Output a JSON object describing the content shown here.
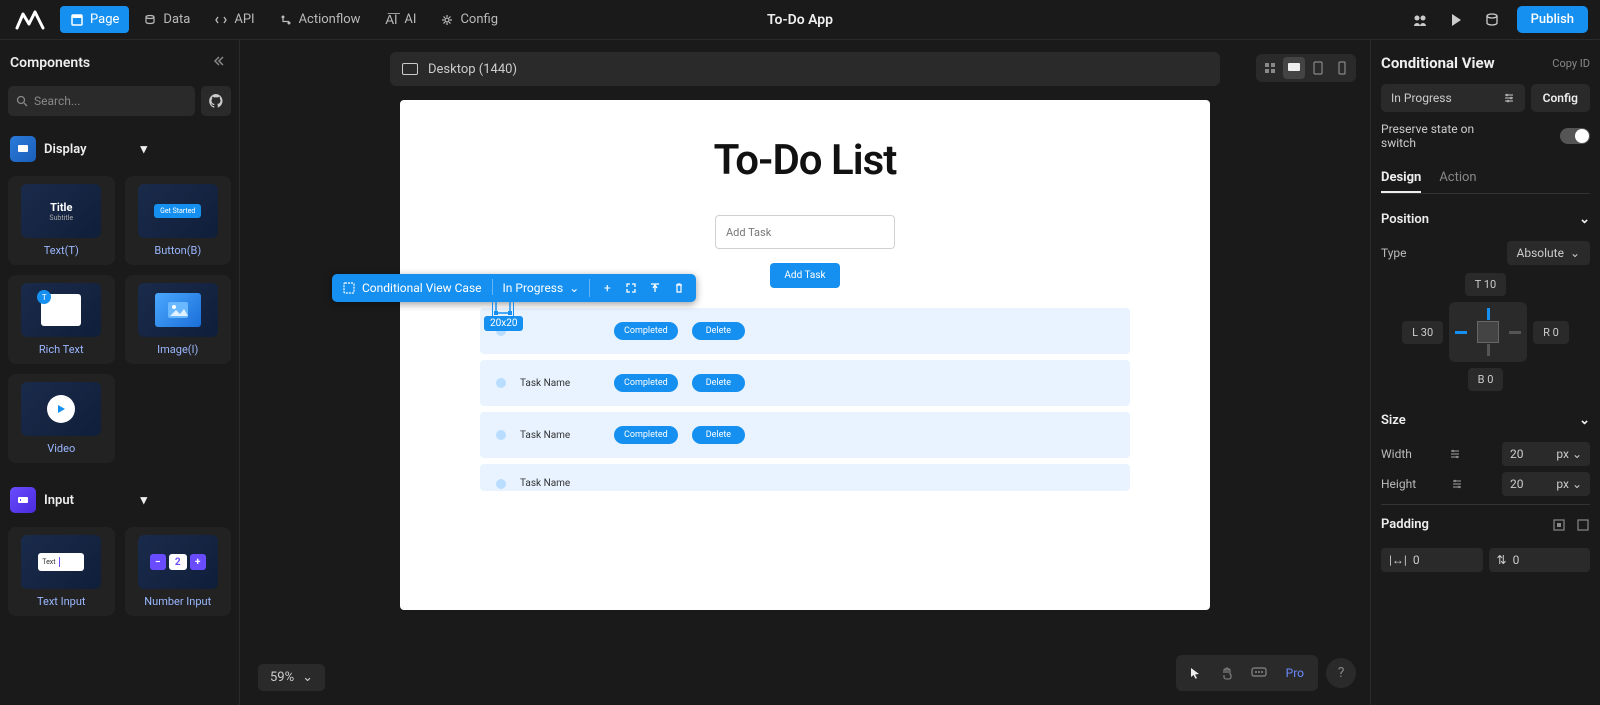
{
  "app_title": "To-Do App",
  "topnav": {
    "page": "Page",
    "data": "Data",
    "api": "API",
    "actionflow": "Actionflow",
    "ai": "AI",
    "config": "Config"
  },
  "publish": "Publish",
  "left": {
    "title": "Components",
    "search_placeholder": "Search...",
    "display_section": "Display",
    "input_section": "Input",
    "components": {
      "text": "Text(T)",
      "button": "Button(B)",
      "richtext": "Rich Text",
      "image": "Image(I)",
      "video": "Video",
      "textinput": "Text Input",
      "numberinput": "Number Input"
    },
    "previews": {
      "title_main": "Title",
      "title_sub": "Subtitle",
      "button_label": "Get Started",
      "textinput_label": "Text"
    }
  },
  "canvas": {
    "device": "Desktop (1440)",
    "page_title": "To-Do List",
    "addtask_placeholder": "Add Task",
    "addtask_button": "Add Task",
    "task_rows": [
      {
        "name": "",
        "completed": "Completed",
        "delete": "Delete"
      },
      {
        "name": "Task Name",
        "completed": "Completed",
        "delete": "Delete"
      },
      {
        "name": "Task Name",
        "completed": "Completed",
        "delete": "Delete"
      },
      {
        "name": "Task Name",
        "completed": "",
        "delete": ""
      }
    ],
    "selection": {
      "label": "Conditional View Case",
      "state": "In Progress",
      "dim": "20x20"
    },
    "zoom": "59%"
  },
  "bottom_tools": {
    "pro": "Pro"
  },
  "right": {
    "title": "Conditional View",
    "copy_id": "Copy ID",
    "state_select": "In Progress",
    "config_btn": "Config",
    "preserve_label": "Preserve state on switch",
    "tabs": {
      "design": "Design",
      "action": "Action"
    },
    "position": {
      "section": "Position",
      "type_label": "Type",
      "type_value": "Absolute",
      "t": "T  10",
      "l": "L  30",
      "r": "R  0",
      "b": "B  0"
    },
    "size": {
      "section": "Size",
      "width_label": "Width",
      "width_value": "20",
      "width_unit": "px",
      "height_label": "Height",
      "height_value": "20",
      "height_unit": "px"
    },
    "padding": {
      "section": "Padding",
      "h_value": "0",
      "v_value": "0"
    }
  }
}
